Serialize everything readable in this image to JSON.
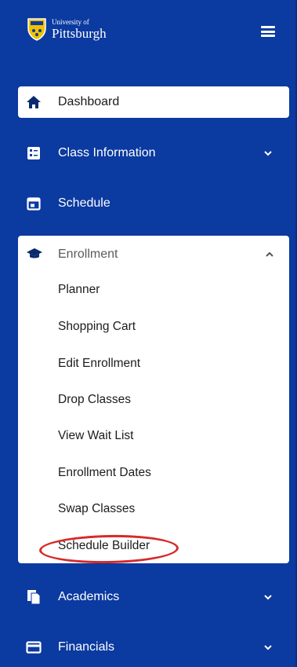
{
  "brand": {
    "small": "University of",
    "big": "Pittsburgh"
  },
  "nav": {
    "dashboard": "Dashboard",
    "class_information": "Class Information",
    "schedule": "Schedule",
    "enrollment": "Enrollment",
    "academics": "Academics",
    "financials": "Financials"
  },
  "enrollment_items": [
    "Planner",
    "Shopping Cart",
    "Edit Enrollment",
    "Drop Classes",
    "View Wait List",
    "Enrollment Dates",
    "Swap Classes",
    "Schedule Builder"
  ],
  "colors": {
    "sidebar": "#0b3aa0",
    "highlight_circle": "#d62a2a"
  }
}
